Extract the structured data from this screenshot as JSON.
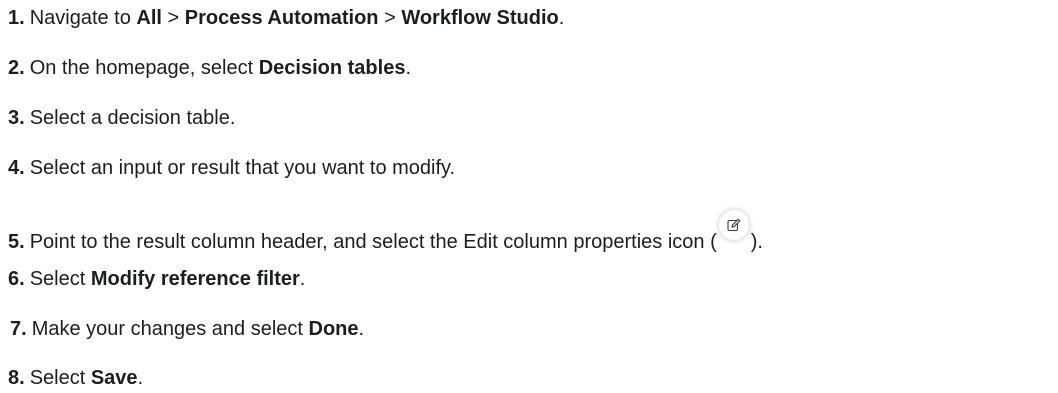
{
  "steps": [
    {
      "number": "1.",
      "parts": {
        "a": "Navigate to ",
        "b": "All",
        "c": " > ",
        "d": "Process Automation",
        "e": " > ",
        "f": "Workflow Studio",
        "g": "."
      }
    },
    {
      "number": "2.",
      "parts": {
        "a": "On the homepage, select ",
        "b": "Decision tables",
        "c": "."
      }
    },
    {
      "number": "3.",
      "parts": {
        "a": "Select a decision table."
      }
    },
    {
      "number": "4.",
      "parts": {
        "a": "Select an input or result that you want to modify."
      }
    },
    {
      "number": "5.",
      "parts": {
        "a": "Point to the result column header, and select the Edit column properties icon (",
        "b": ")."
      },
      "icon": "pencil-edit-icon"
    },
    {
      "number": "6.",
      "parts": {
        "a": "Select ",
        "b": "Modify reference filter",
        "c": "."
      }
    },
    {
      "number": "7.",
      "parts": {
        "a": "Make your changes and select ",
        "b": "Done",
        "c": "."
      }
    },
    {
      "number": "8.",
      "parts": {
        "a": "Select ",
        "b": "Save",
        "c": "."
      }
    }
  ]
}
